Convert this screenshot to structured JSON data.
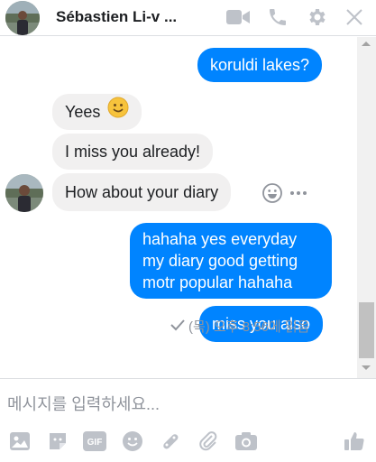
{
  "header": {
    "name": "Sébastien Li-v ...",
    "icons": [
      "video-call-icon",
      "phone-icon",
      "gear-icon",
      "close-icon"
    ]
  },
  "messages": [
    {
      "from": "me",
      "text": "koruldi lakes?"
    },
    {
      "from": "them",
      "text": "Yees 🙂"
    },
    {
      "from": "them",
      "text": "I miss you already!"
    },
    {
      "from": "them",
      "text": "How about your diary"
    },
    {
      "from": "me",
      "lines": [
        "hahaha yes everyday",
        "my diary good getting",
        "motr popular hahaha"
      ]
    },
    {
      "from": "me",
      "text": "miss you also"
    }
  ],
  "receipt": "(목) 오후 8:56에 읽음",
  "compose": {
    "placeholder": "메시지를 입력하세요...",
    "tools": [
      "photo-icon",
      "sticker-icon",
      "gif-icon",
      "emoji-icon",
      "game-icon",
      "attachment-icon",
      "camera-icon",
      "like-icon"
    ]
  },
  "colors": {
    "accent": "#0084ff",
    "incoming": "#f1f0f0",
    "muted": "#90949c"
  }
}
